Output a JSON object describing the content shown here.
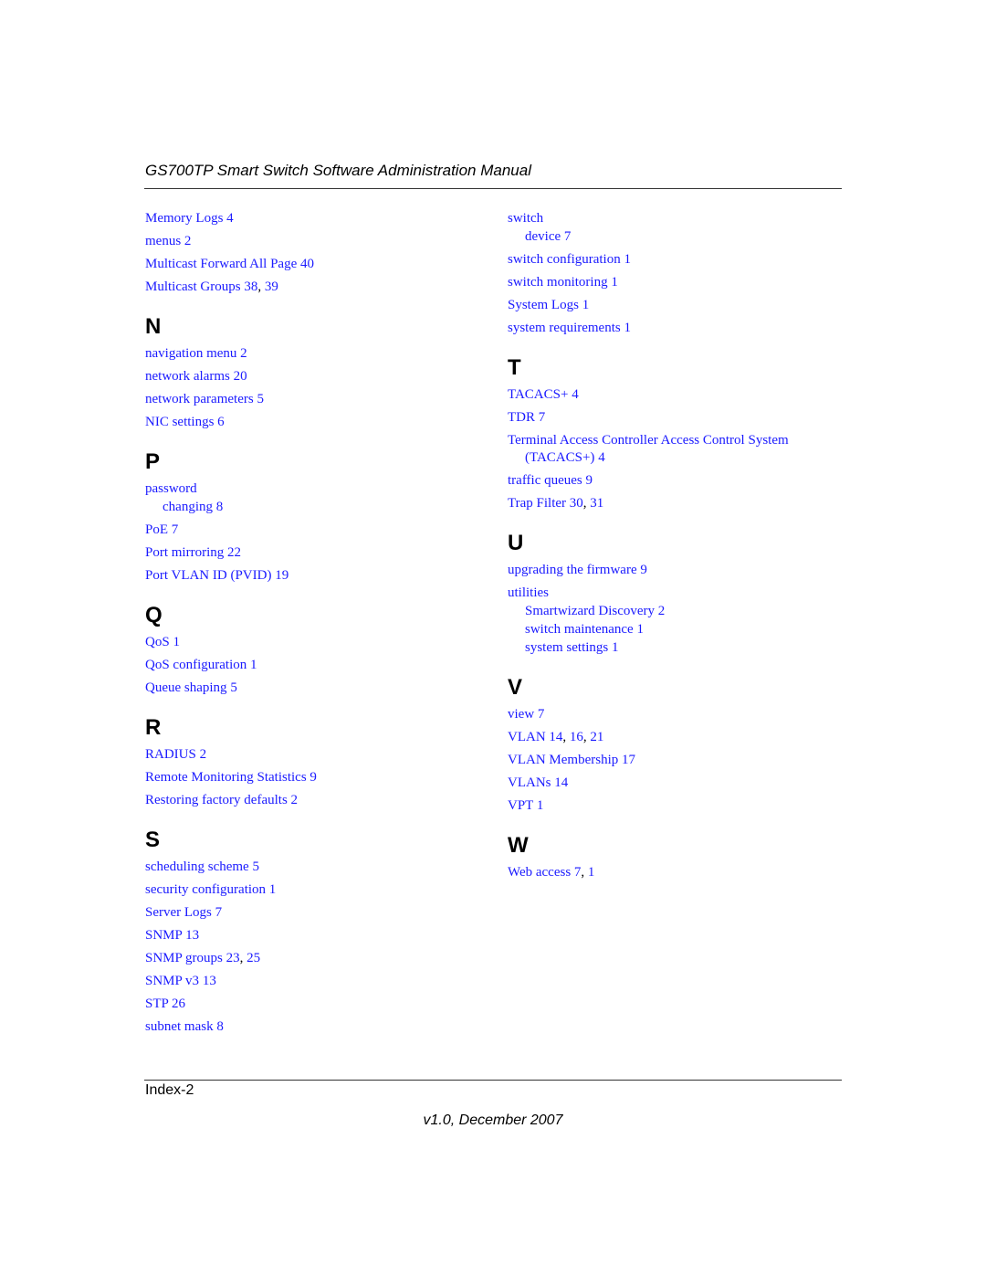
{
  "header": {
    "title": "GS700TP Smart Switch Software Administration Manual"
  },
  "footer": {
    "page_label": "Index-2",
    "version": "v1.0, December 2007"
  },
  "colors": {
    "link": "#1a1aff",
    "text": "#000000"
  },
  "left_column": [
    {
      "letter": null,
      "entries": [
        {
          "term": "Memory Logs",
          "pages": [
            "4"
          ]
        },
        {
          "term": "menus",
          "pages": [
            "2"
          ]
        },
        {
          "term": "Multicast Forward All Page",
          "pages": [
            "40"
          ]
        },
        {
          "term": "Multicast Groups",
          "pages": [
            "38",
            "39"
          ]
        }
      ]
    },
    {
      "letter": "N",
      "entries": [
        {
          "term": "navigation menu",
          "pages": [
            "2"
          ]
        },
        {
          "term": "network alarms",
          "pages": [
            "20"
          ]
        },
        {
          "term": "network parameters",
          "pages": [
            "5"
          ]
        },
        {
          "term": "NIC settings",
          "pages": [
            "6"
          ]
        }
      ]
    },
    {
      "letter": "P",
      "entries": [
        {
          "term": "password",
          "pages": [],
          "subs": [
            {
              "term": "changing",
              "pages": [
                "8"
              ]
            }
          ]
        },
        {
          "term": "PoE",
          "pages": [
            "7"
          ]
        },
        {
          "term": "Port mirroring",
          "pages": [
            "22"
          ]
        },
        {
          "term": "Port VLAN ID (PVID)",
          "pages": [
            "19"
          ]
        }
      ]
    },
    {
      "letter": "Q",
      "entries": [
        {
          "term": "QoS",
          "pages": [
            "1"
          ]
        },
        {
          "term": "QoS configuration",
          "pages": [
            "1"
          ]
        },
        {
          "term": "Queue shaping",
          "pages": [
            "5"
          ]
        }
      ]
    },
    {
      "letter": "R",
      "entries": [
        {
          "term": "RADIUS",
          "pages": [
            "2"
          ]
        },
        {
          "term": "Remote Monitoring Statistics",
          "pages": [
            "9"
          ]
        },
        {
          "term": "Restoring factory defaults",
          "pages": [
            "2"
          ]
        }
      ]
    },
    {
      "letter": "S",
      "entries": [
        {
          "term": "scheduling scheme",
          "pages": [
            "5"
          ]
        },
        {
          "term": "security configuration",
          "pages": [
            "1"
          ]
        },
        {
          "term": "Server Logs",
          "pages": [
            "7"
          ]
        },
        {
          "term": "SNMP",
          "pages": [
            "13"
          ]
        },
        {
          "term": "SNMP groups",
          "pages": [
            "23",
            "25"
          ]
        },
        {
          "term": "SNMP v3",
          "pages": [
            "13"
          ]
        },
        {
          "term": "STP",
          "pages": [
            "26"
          ]
        },
        {
          "term": "subnet mask",
          "pages": [
            "8"
          ]
        }
      ]
    }
  ],
  "right_column": [
    {
      "letter": null,
      "entries": [
        {
          "term": "switch",
          "pages": [],
          "subs": [
            {
              "term": "device",
              "pages": [
                "7"
              ]
            }
          ]
        },
        {
          "term": "switch configuration",
          "pages": [
            "1"
          ]
        },
        {
          "term": "switch monitoring",
          "pages": [
            "1"
          ]
        },
        {
          "term": "System Logs",
          "pages": [
            "1"
          ]
        },
        {
          "term": "system requirements",
          "pages": [
            "1"
          ]
        }
      ]
    },
    {
      "letter": "T",
      "entries": [
        {
          "term": "TACACS+",
          "pages": [
            "4"
          ]
        },
        {
          "term": "TDR",
          "pages": [
            "7"
          ]
        },
        {
          "term": "Terminal Access Controller Access Control System",
          "wrap": "(TACACS+)",
          "pages": [
            "4"
          ]
        },
        {
          "term": "traffic queues",
          "pages": [
            "9"
          ]
        },
        {
          "term": "Trap Filter",
          "pages": [
            "30",
            "31"
          ]
        }
      ]
    },
    {
      "letter": "U",
      "entries": [
        {
          "term": "upgrading the firmware",
          "pages": [
            "9"
          ]
        },
        {
          "term": "utilities",
          "pages": [],
          "subs": [
            {
              "term": "Smartwizard Discovery",
              "pages": [
                "2"
              ]
            },
            {
              "term": "switch maintenance",
              "pages": [
                "1"
              ]
            },
            {
              "term": "system settings",
              "pages": [
                "1"
              ]
            }
          ]
        }
      ]
    },
    {
      "letter": "V",
      "entries": [
        {
          "term": "view",
          "pages": [
            "7"
          ]
        },
        {
          "term": "VLAN",
          "pages": [
            "14",
            "16",
            "21"
          ]
        },
        {
          "term": "VLAN Membership",
          "pages": [
            "17"
          ]
        },
        {
          "term": "VLANs",
          "pages": [
            "14"
          ]
        },
        {
          "term": "VPT",
          "pages": [
            "1"
          ]
        }
      ]
    },
    {
      "letter": "W",
      "entries": [
        {
          "term": "Web access",
          "pages": [
            "7",
            "1"
          ]
        }
      ]
    }
  ]
}
